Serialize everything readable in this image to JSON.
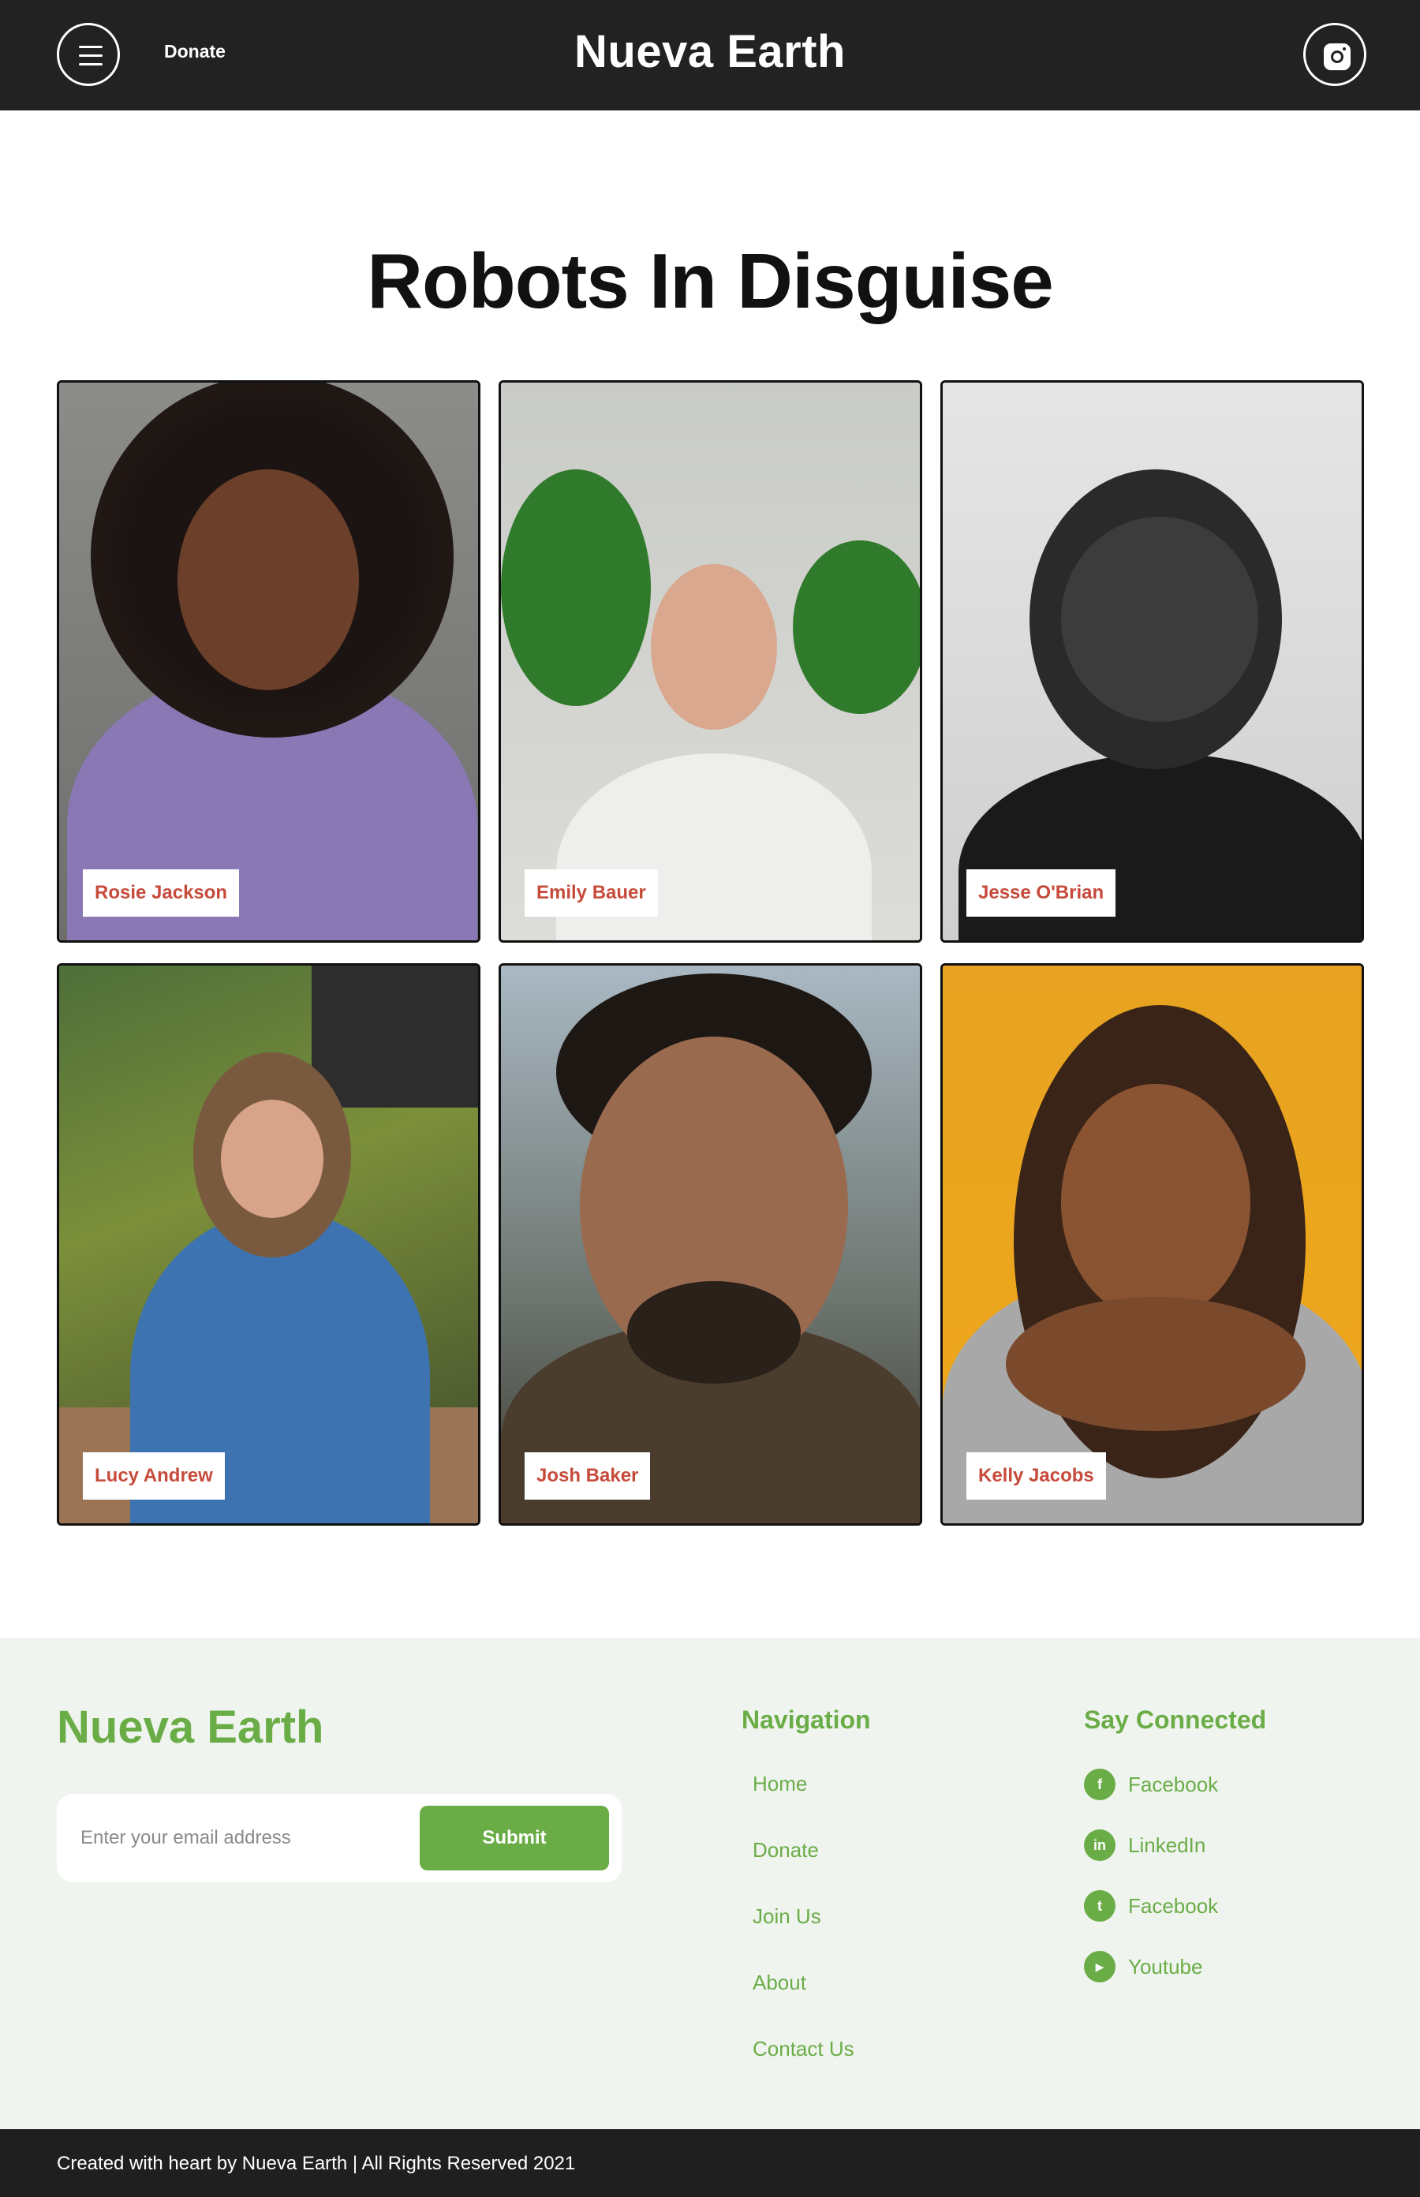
{
  "header": {
    "menu_icon": "hamburger-menu-icon",
    "donate_label": "Donate",
    "brand": "Nueva Earth",
    "social_icon": "instagram-icon"
  },
  "main": {
    "title": "Robots In Disguise",
    "team": [
      {
        "name": "Rosie Jackson"
      },
      {
        "name": "Emily Bauer"
      },
      {
        "name": "Jesse O'Brian"
      },
      {
        "name": "Lucy Andrew"
      },
      {
        "name": "Josh Baker"
      },
      {
        "name": "Kelly Jacobs"
      }
    ]
  },
  "footer": {
    "brand": "Nueva Earth",
    "email_placeholder": "Enter your email address",
    "submit_label": "Submit",
    "navigation_heading": "Navigation",
    "navigation": [
      "Home",
      "Donate",
      "Join Us",
      "About",
      "Contact Us"
    ],
    "social_heading": "Say Connected",
    "social": [
      {
        "label": "Facebook",
        "icon": "facebook-icon",
        "glyph": "f"
      },
      {
        "label": "LinkedIn",
        "icon": "linkedin-icon",
        "glyph": "in"
      },
      {
        "label": "Facebook",
        "icon": "twitter-icon",
        "glyph": "t"
      },
      {
        "label": "Youtube",
        "icon": "youtube-icon",
        "glyph": "▶"
      }
    ],
    "copyright": "Created with heart by Nueva Earth | All Rights Reserved 2021"
  },
  "colors": {
    "header_bg": "#222222",
    "accent_green": "#6aad47",
    "name_tag_text": "#c64b3b",
    "footer_bg": "#f0f4ef"
  }
}
